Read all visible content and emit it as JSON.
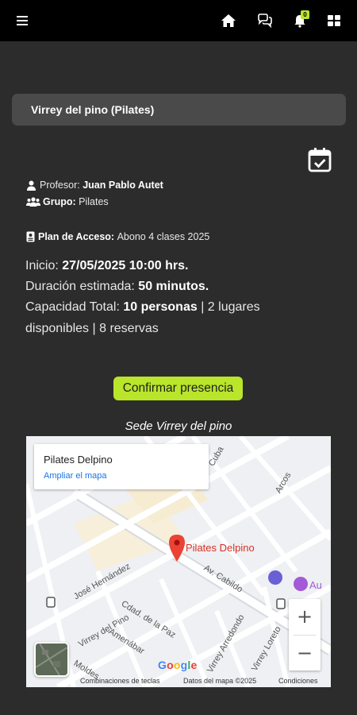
{
  "topbar": {
    "icons": [
      "menu-icon",
      "home-icon",
      "chat-icon",
      "bell-icon",
      "apps-icon"
    ],
    "notification_count": "0"
  },
  "class": {
    "title": "Virrey del pino (Pilates)",
    "professor_label": "Profesor:",
    "professor": "Juan Pablo Autet",
    "group_label": "Grupo:",
    "group": "Pilates",
    "plan_label": "Plan de Acceso:",
    "plan": "Abono 4 clases 2025",
    "start_label": "Inicio:",
    "start": "27/05/2025 10:00 hrs.",
    "duration_label": "Duración estimada:",
    "duration": "50 minutos.",
    "capacity_label": "Capacidad Total:",
    "capacity": "10 personas",
    "availability_1": "| 2 lugares",
    "availability_2": "disponibles | 8 reservas"
  },
  "actions": {
    "confirm_label": "Confirmar presencia"
  },
  "venue": {
    "title": "Sede Virrey del pino"
  },
  "map": {
    "place_name": "Pilates Delpino",
    "enlarge_label": "Ampliar el mapa",
    "pin_label": "Pilates Delpino",
    "zoom_in": "+",
    "zoom_out": "−",
    "footer_shortcuts": "Combinaciones de teclas",
    "footer_data": "Datos del mapa ©2025",
    "footer_terms": "Condiciones",
    "google": [
      "G",
      "o",
      "o",
      "g",
      "l",
      "e"
    ],
    "streets": {
      "cuba": "Cuba",
      "arcos": "Arcos",
      "jose_hernandez": "José Hernández",
      "cabildo": "Av. Cabildo",
      "virrey_del_pino": "Virrey del Pino",
      "cdad_de_la_paz": "Cdad. de la Paz",
      "amenabar": "Amenábar",
      "virrey_arredondo": "Virrey Arredondo",
      "virrey_loreto": "Virrey Loreto",
      "moldes": "Moldes",
      "au": "Au"
    }
  },
  "colors": {
    "accent": "#b9e52a",
    "background": "#2c2c2c",
    "card": "#4a4a4a",
    "topbar": "#000000",
    "map_pin": "#d93025",
    "map_link": "#1a73e8"
  }
}
